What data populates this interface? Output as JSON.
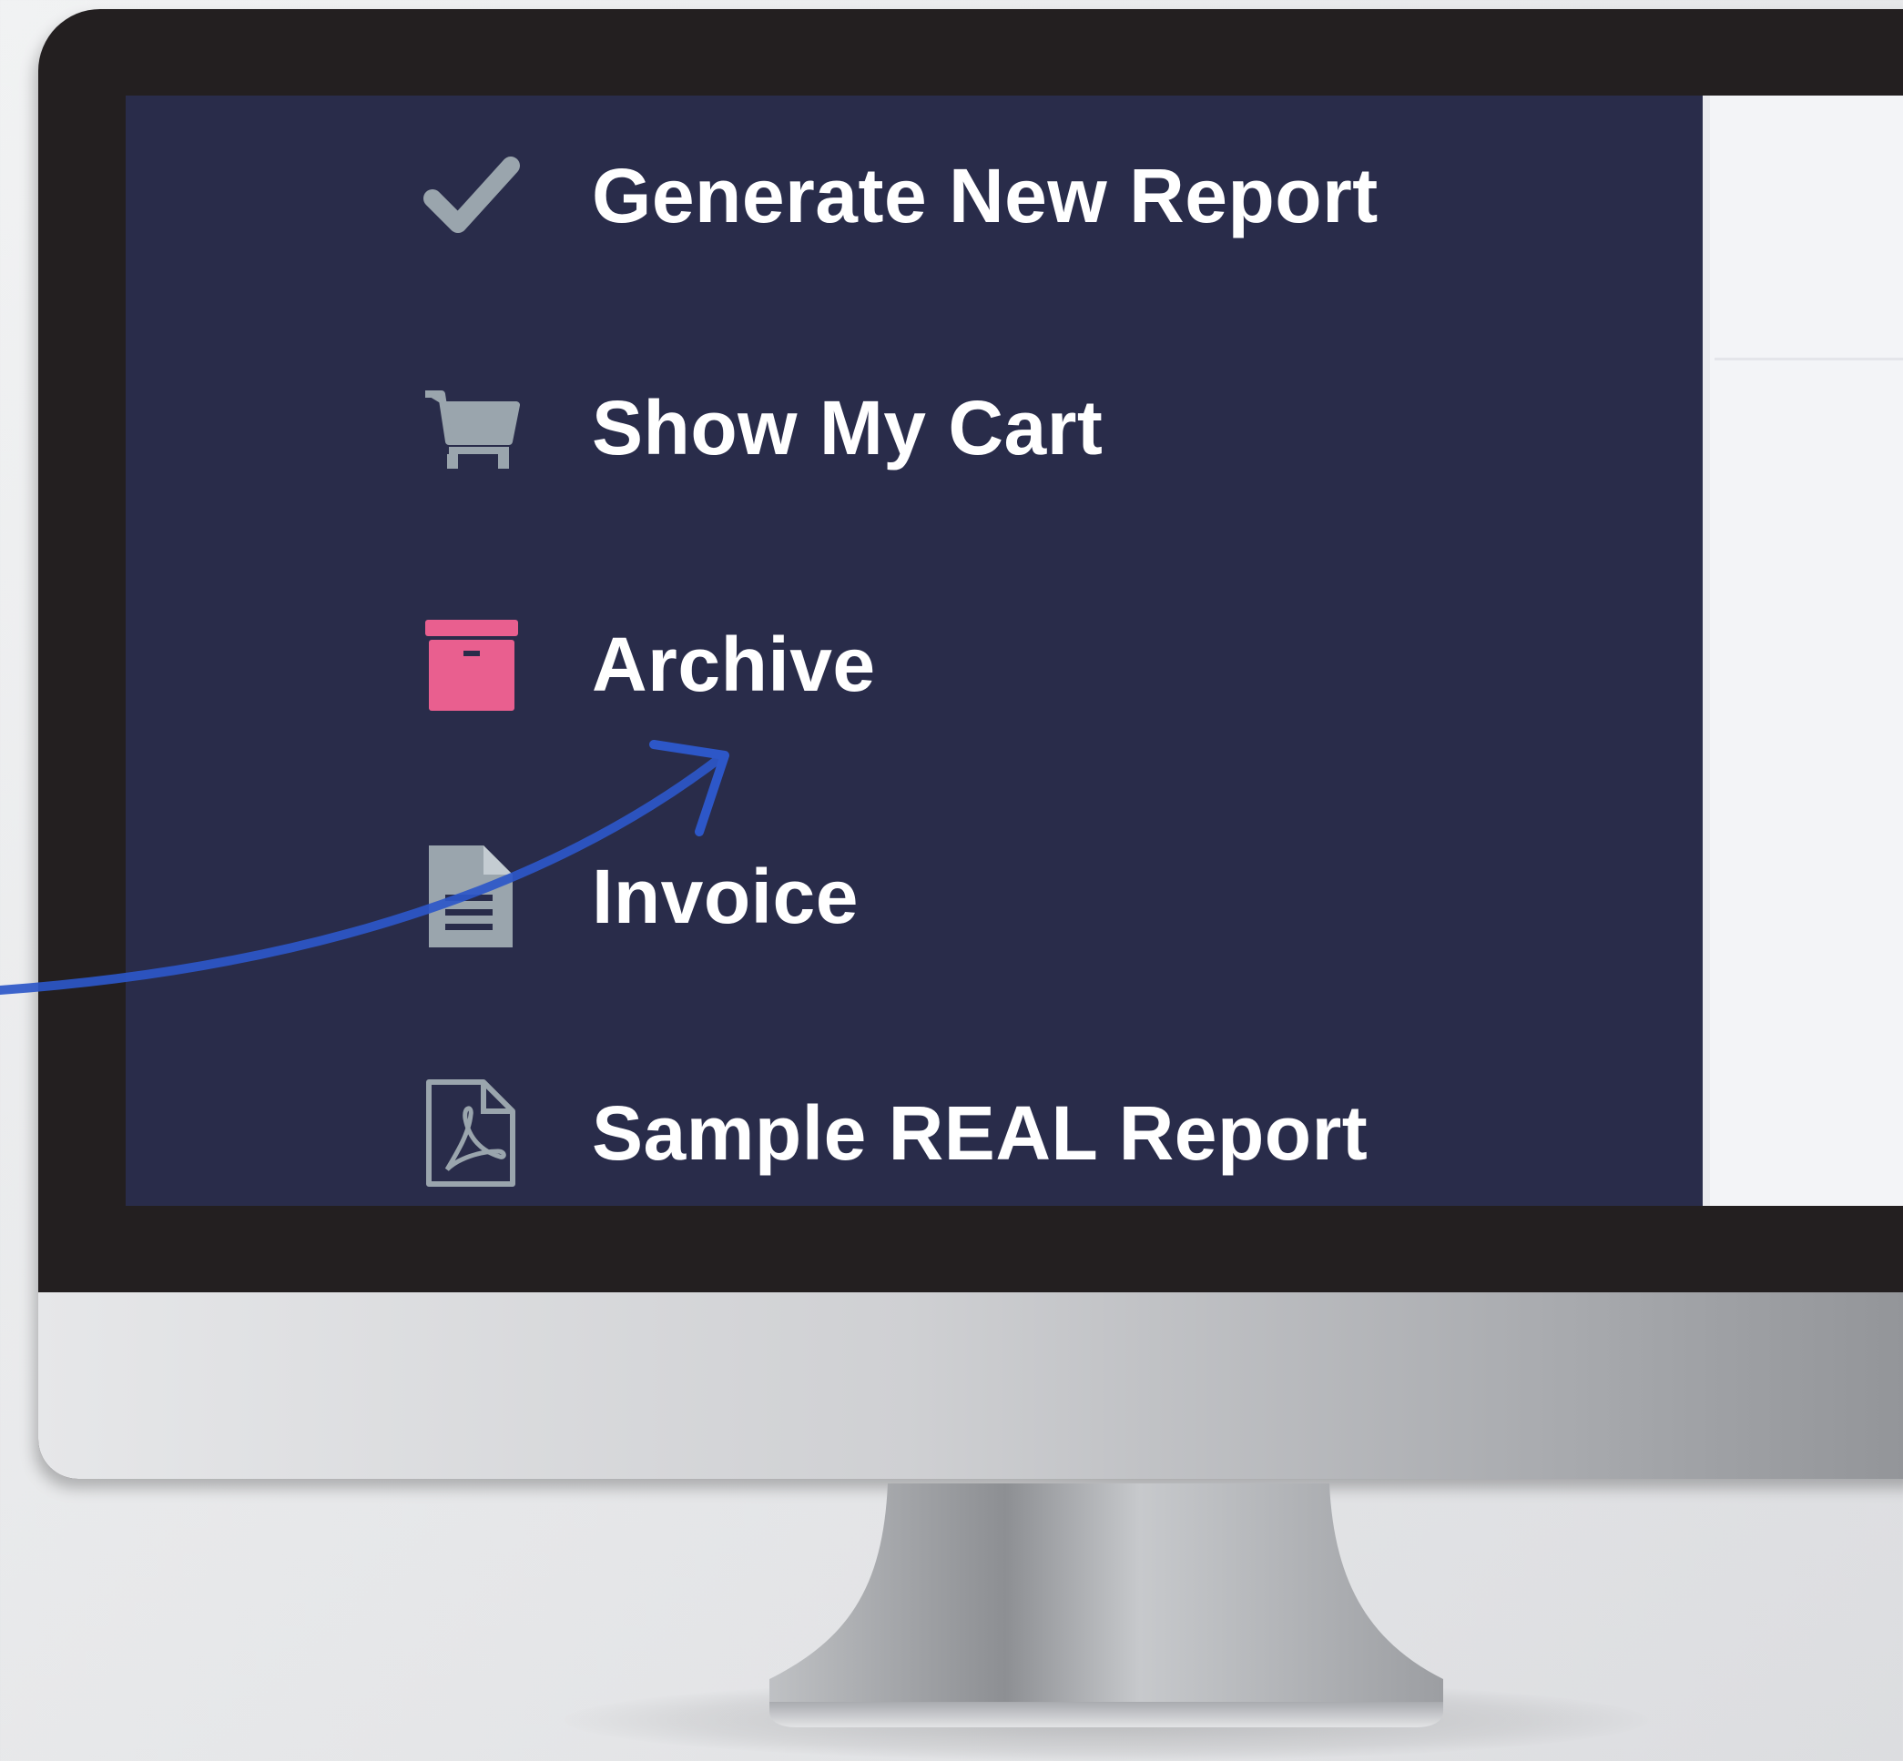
{
  "sidebar": {
    "items": [
      {
        "label": "Generate New Report",
        "icon": "checkmark-icon",
        "icon_color": "#9aa5ad"
      },
      {
        "label": "Show My Cart",
        "icon": "shopping-cart-icon",
        "icon_color": "#9aa5ad"
      },
      {
        "label": "Archive",
        "icon": "archive-box-icon",
        "icon_color": "#e95f8f"
      },
      {
        "label": "Invoice",
        "icon": "document-icon",
        "icon_color": "#9aa5ad"
      },
      {
        "label": "Sample REAL Report",
        "icon": "pdf-file-icon",
        "icon_color": "#9aa5ad"
      }
    ]
  },
  "colors": {
    "sidebar_background": "#292c4a",
    "bezel": "#231f20",
    "annotation_arrow": "#2d57c8",
    "label_text": "#ffffff"
  }
}
